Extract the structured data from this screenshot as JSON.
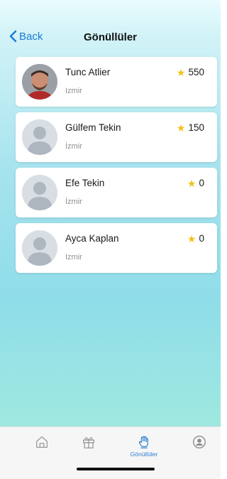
{
  "nav": {
    "back_label": "Back",
    "title": "Gönüllüler"
  },
  "volunteers": [
    {
      "name": "Tunc Atlier",
      "city": "Izmir",
      "points": "550",
      "avatar": "photo"
    },
    {
      "name": "Gülfem Tekin",
      "city": "İzmir",
      "points": "150",
      "avatar": "placeholder"
    },
    {
      "name": "Efe Tekin",
      "city": "İzmir",
      "points": "0",
      "avatar": "placeholder"
    },
    {
      "name": "Ayca Kaplan",
      "city": "Izmir",
      "points": "0",
      "avatar": "placeholder"
    }
  ],
  "tabbar": {
    "items": [
      {
        "icon": "home-icon",
        "label": ""
      },
      {
        "icon": "gift-icon",
        "label": ""
      },
      {
        "icon": "volunteer-hand-icon",
        "label": "Gönüllüler",
        "active": true
      },
      {
        "icon": "profile-icon",
        "label": ""
      }
    ]
  },
  "colors": {
    "accent": "#1a7bd6",
    "star": "#f3c016",
    "card": "#ffffff"
  }
}
